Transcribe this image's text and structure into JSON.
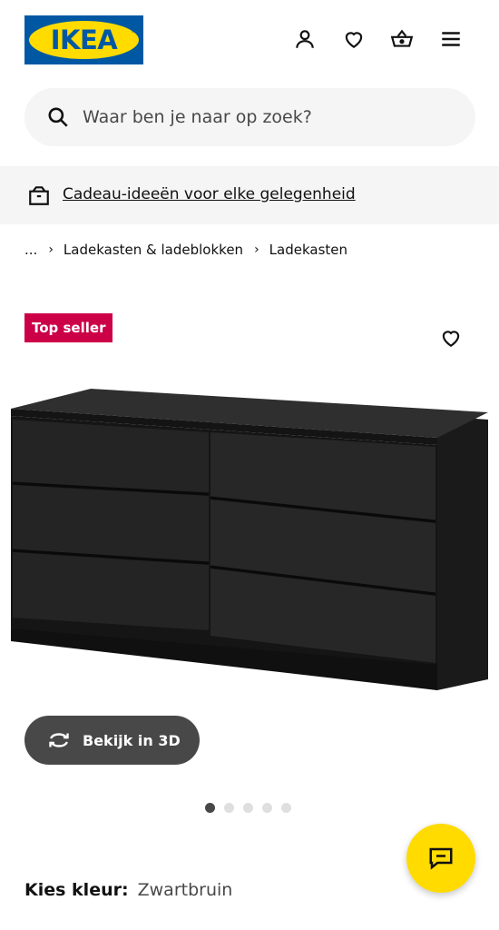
{
  "header": {
    "logo_text": "IKEA",
    "logo_reg": "®",
    "icons": [
      "account-icon",
      "heart-icon",
      "basket-icon",
      "menu-icon"
    ]
  },
  "search": {
    "placeholder": "Waar ben je naar op zoek?"
  },
  "promo": {
    "icon": "gift-box-icon",
    "link_text": "Cadeau-ideeën voor elke gelegenheid"
  },
  "breadcrumb": {
    "items": [
      "...",
      "Ladekasten & ladeblokken",
      "Ladekasten"
    ]
  },
  "product": {
    "badge": "Top seller",
    "view_3d_label": "Bekijk in 3D",
    "image_count": 5,
    "active_image": 1,
    "color_label": "Kies kleur:",
    "color_value": "Zwartbruin"
  },
  "colors": {
    "ikea_blue": "#0058a3",
    "ikea_yellow": "#ffdb00",
    "badge_red": "#cc0047",
    "dark_button": "#484848"
  }
}
